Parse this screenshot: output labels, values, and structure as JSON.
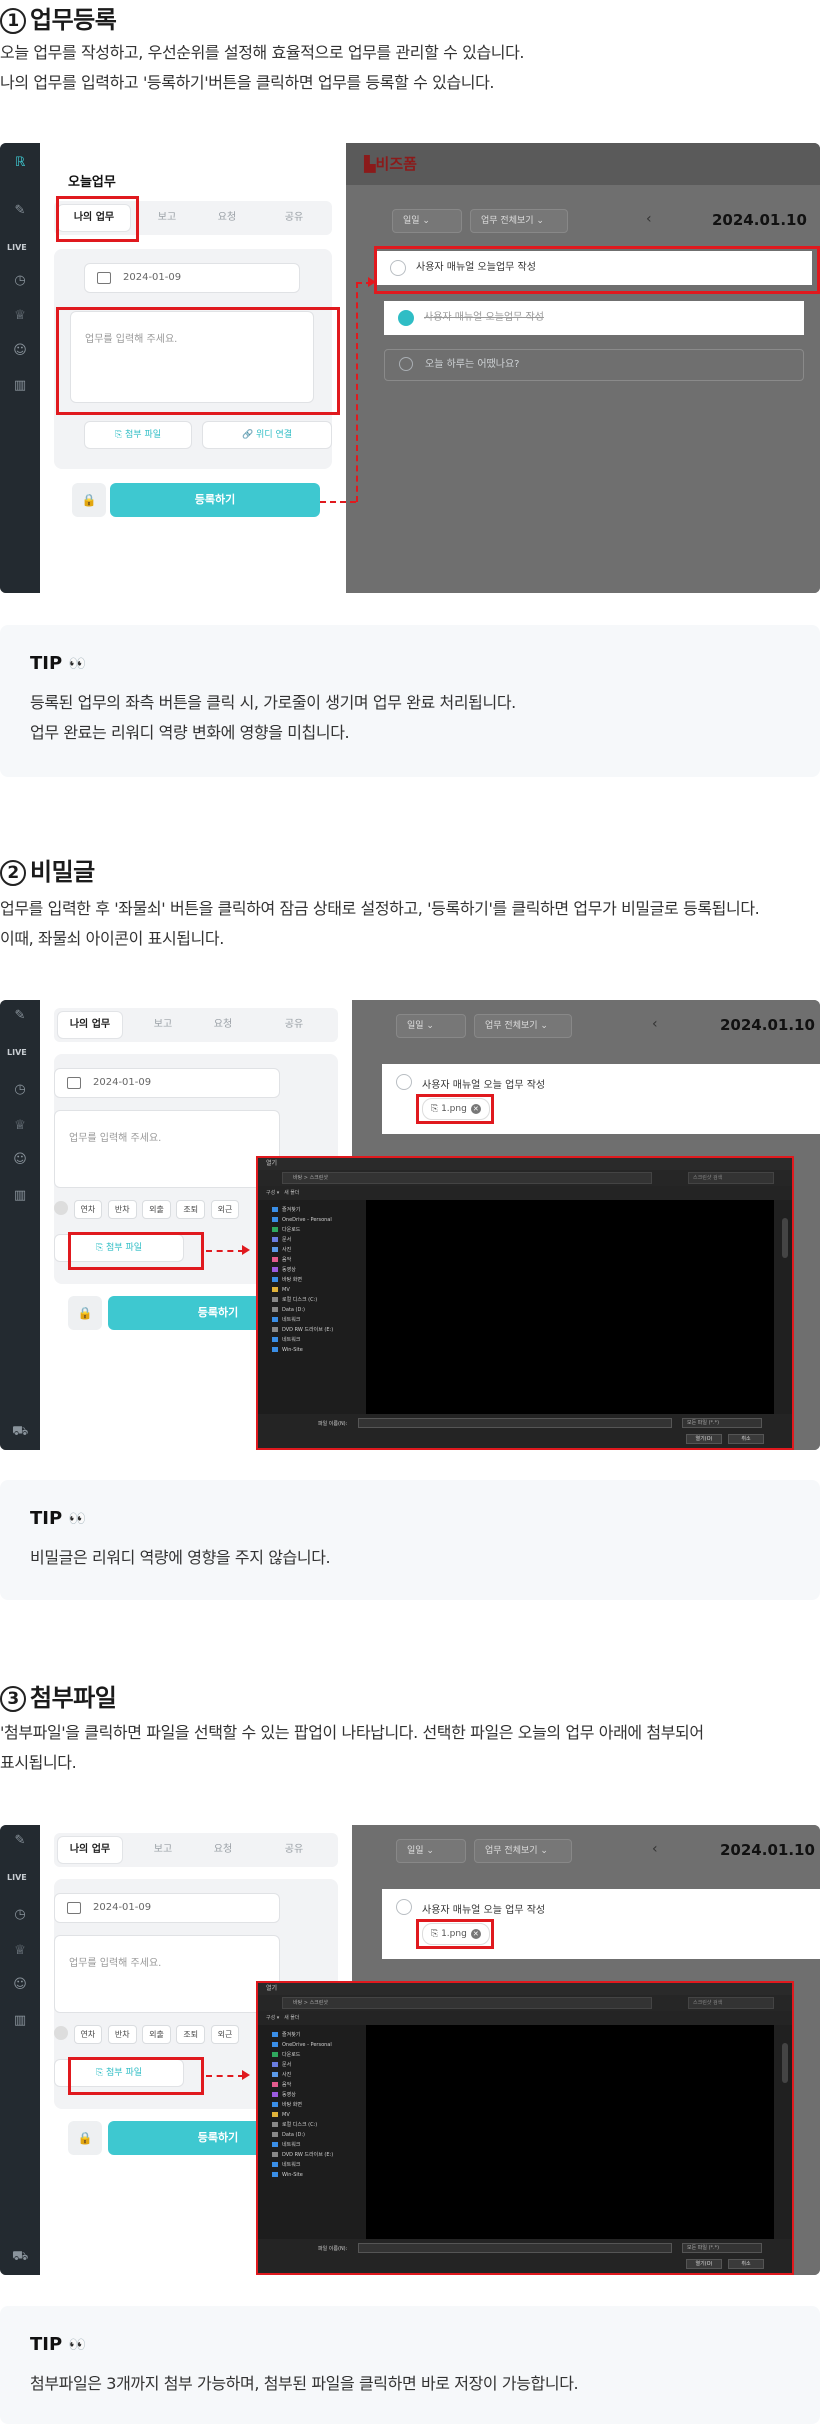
{
  "colors": {
    "accent": "#3ec8d0",
    "highlight": "#e0191e",
    "sidebar": "#232a30",
    "overlay": "#6f6f6f",
    "brand": "#8b1a1a"
  },
  "section1": {
    "num": "1",
    "title": "업무등록",
    "desc1": "오늘 업무를 작성하고, 우선순위를 설정해 효율적으로 업무를 관리할 수 있습니다.",
    "desc2": "나의 업무를 입력하고 '등록하기'버튼을 클릭하면 업무를 등록할 수 있습니다.",
    "shot": {
      "brand_logo": "비즈폼",
      "panel_title": "오늘업무",
      "tabs": [
        "나의 업무",
        "보고",
        "요청",
        "공유"
      ],
      "date_value": "2024-01-09",
      "textarea_placeholder": "업무를 입력해 주세요.",
      "attach_label": "첨부 파일",
      "link_label": "위디 연결",
      "submit_label": "등록하기",
      "filter_all": "일일",
      "filter_view": "업무 전체보기",
      "date_label": "2024.01.10",
      "todo_items": [
        {
          "text": "사용자 매뉴얼 오늘업무 작성",
          "done": false
        },
        {
          "text": "사용자 매뉴얼 오늘업무 작성",
          "done": true
        },
        {
          "text": "오늘 하루는 어땠나요?",
          "done": false
        }
      ],
      "rail_live": "LIVE"
    },
    "tip_title": "TIP",
    "tip_line1": "등록된 업무의 좌측 버튼을 클릭 시, 가로줄이 생기며 업무 완료 처리됩니다.",
    "tip_line2": "업무 완료는 리워디 역량 변화에 영향을 미칩니다."
  },
  "section2": {
    "num": "2",
    "title": "비밀글",
    "desc1": "업무를 입력한 후 '좌물쇠' 버튼을 클릭하여 잠금 상태로 설정하고, '등록하기'를 클릭하면 업무가 비밀글로 등록됩니다.",
    "desc2": "이때, 좌물쇠 아이콘이 표시됩니다.",
    "tip_title": "TIP",
    "tip_line1": "비밀글은 리워디 역량에 영향을 주지 않습니다."
  },
  "section3": {
    "num": "3",
    "title": "첨부파일",
    "desc1": "'첨부파일'을 클릭하면 파일을 선택할 수 있는 팝업이 나타납니다. 선택한 파일은 오늘의 업무 아래에 첨부되어",
    "desc2": "표시됩니다.",
    "tip_title": "TIP",
    "tip_line1": "첨부파일은 3개까지 첨부 가능하며, 첨부된 파일을 클릭하면 바로 저장이 가능합니다."
  },
  "shot2": {
    "tabs": [
      "나의 업무",
      "보고",
      "요청",
      "공유"
    ],
    "date_value": "2024-01-09",
    "textarea_placeholder": "업무를 입력해 주세요.",
    "format_buttons": [
      "연차",
      "반차",
      "외출",
      "조퇴",
      "외근"
    ],
    "attach_label": "첨부 파일",
    "submit_label": "등록하기",
    "filter_all": "일일",
    "filter_view": "업무 전체보기",
    "date_label": "2024.01.10",
    "todo_text": "사용자 매뉴얼 오늘 업무 작성",
    "file_chip": "1.png",
    "rail_live": "LIVE",
    "dialog": {
      "title": "열기",
      "path": "바탕 > 스크린샷",
      "search": "스크린샷 검색",
      "tool_left": "구성 ▾",
      "tool_new": "새 폴더",
      "side_items": [
        "즐겨찾기",
        "OneDrive - Personal",
        "다운로드",
        "문서",
        "사진",
        "음악",
        "동영상",
        "바탕 화면",
        "MV",
        "로컬 디스크 (C:)",
        "Data (D:)",
        "네트워크",
        "DVD RW 드라이브 (E:)",
        "네트워크",
        "Win-Site"
      ],
      "filename_label": "파일 이름(N):",
      "filetype": "모든 파일 (*.*)",
      "open_btn": "열기(O)",
      "cancel_btn": "취소"
    }
  }
}
